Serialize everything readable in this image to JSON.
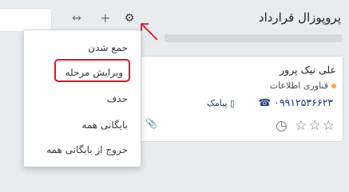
{
  "column": {
    "title": "پروپوزال قرارداد",
    "fold_icon": "↔",
    "add_icon": "+",
    "gear_icon": "⚙"
  },
  "card": {
    "name": "علی نیک پرور",
    "company": "فناوری اطلاعات",
    "phone": "۰۹۹۱۲۵۳۶۶۲۳",
    "sms_label": "پیامک",
    "phone_icon": "☎",
    "sms_icon": "▯",
    "clock_icon": "◷",
    "stars": "☆☆☆",
    "clip_icon": "📎"
  },
  "dropdown": {
    "items": [
      {
        "label": "جمع شدن"
      },
      {
        "label": "ویرایش مرحله",
        "highlighted": true
      },
      {
        "label": "حذف"
      },
      {
        "label": "بایگانی همه"
      },
      {
        "label": "خروج از بایگانی همه"
      }
    ]
  },
  "colors": {
    "highlight": "#e3111e",
    "arrow": "#e3111e",
    "company_dot": "#f0ad4e",
    "link": "#1b3b6f"
  }
}
